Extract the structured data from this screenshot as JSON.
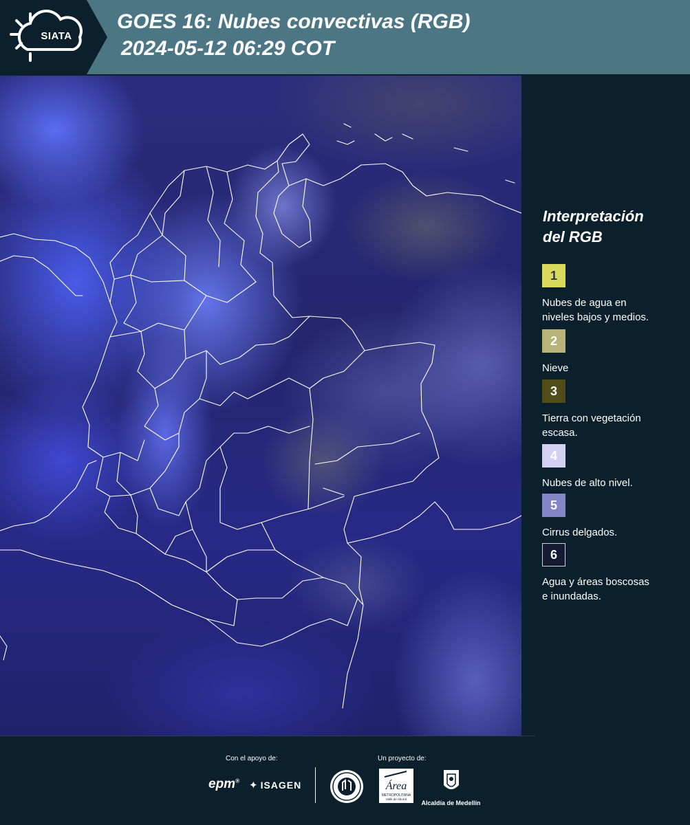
{
  "header": {
    "logo_text": "SIATA",
    "title_line1": "GOES 16: Nubes convectivas (RGB)",
    "title_line2": "2024-05-12 06:29 COT"
  },
  "legend": {
    "title_line1": "Interpretación",
    "title_line2": "del RGB",
    "items": [
      {
        "number": "1",
        "label_line1": "Nubes de agua en",
        "label_line2": "niveles bajos y medios.",
        "color": "#d9d95b",
        "text_color": "#2a3a3a"
      },
      {
        "number": "2",
        "label_line1": "Nieve",
        "label_line2": "",
        "color": "#b7b378",
        "text_color": "#ffffff"
      },
      {
        "number": "3",
        "label_line1": "Tierra con vegetación",
        "label_line2": "escasa.",
        "color": "#514d19",
        "text_color": "#ffffff"
      },
      {
        "number": "4",
        "label_line1": "Nubes de alto nivel.",
        "label_line2": "",
        "color": "#d3d0f4",
        "text_color": "#ffffff"
      },
      {
        "number": "5",
        "label_line1": "Cirrus delgados.",
        "label_line2": "",
        "color": "#8684c9",
        "text_color": "#ffffff"
      },
      {
        "number": "6",
        "label_line1": "Agua y áreas boscosas",
        "label_line2": "e inundadas.",
        "color": "#161a30",
        "text_color": "#ffffff"
      }
    ]
  },
  "footer": {
    "support_label": "Con el apoyo de:",
    "project_label": "Un proyecto de:",
    "epm": "epm",
    "isagen": "ISAGEN",
    "amva_main": "Área",
    "amva_sub": "METROPOLITANA",
    "amva_sub2": "Valle de Aburrá",
    "alcaldia": "Alcaldía de Medellín"
  },
  "colors": {
    "header_bg": "#4d7685",
    "panel_bg": "#0b1f2c",
    "logo_bg": "#0b1f2c",
    "border_lines": "#ffffff"
  }
}
